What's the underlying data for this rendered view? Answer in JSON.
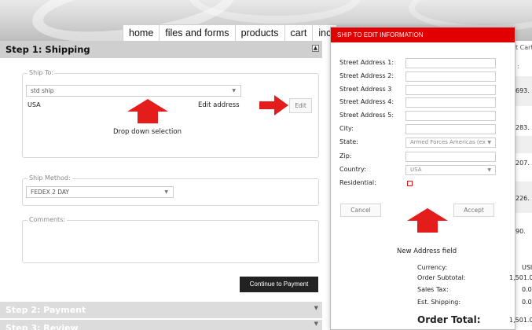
{
  "nav": {
    "items": [
      "home",
      "files and forms",
      "products",
      "cart",
      "inc"
    ]
  },
  "step1": {
    "title": "Step 1: Shipping",
    "toggle_icon": "collapse-icon",
    "ship_to": {
      "legend": "Ship To:",
      "selected": "std ship",
      "country": "USA",
      "edit_address_label": "Edit address",
      "edit_button": "Edit",
      "annotation": "Drop down selection"
    },
    "ship_method": {
      "legend": "Ship Method:",
      "selected": "FEDEX 2 DAY"
    },
    "comments": {
      "legend": "Comments:"
    },
    "continue_button": "Continue to Payment"
  },
  "step2": {
    "title": "Step 2: Payment"
  },
  "step3": {
    "title": "Step 3: Review"
  },
  "cart": {
    "header": "t Cart",
    "sub": ":",
    "rows": [
      "693.",
      "283.",
      "207.",
      "226.",
      "90."
    ]
  },
  "modal": {
    "title": "Ship to Edit Information",
    "fields": [
      {
        "label": "Street Address 1:",
        "value": ""
      },
      {
        "label": "Street Address 2:",
        "value": ""
      },
      {
        "label": "Street Address 3",
        "value": ""
      },
      {
        "label": "Street Address 4:",
        "value": ""
      },
      {
        "label": "Street Address 5:",
        "value": ""
      },
      {
        "label": "City:",
        "value": ""
      }
    ],
    "state_label": "State:",
    "state_value": "Armed Forces Americas (ex",
    "zip_label": "Zip:",
    "country_label": "Country:",
    "country_value": "USA",
    "residential_label": "Residential:",
    "cancel_button": "Cancel",
    "accept_button": "Accept",
    "annotation": "New Address field"
  },
  "totals": {
    "currency_label": "Currency:",
    "currency_value": "USI",
    "subtotal_label": "Order Subtotal:",
    "subtotal_value": "1,501.0",
    "tax_label": "Sales Tax:",
    "tax_value": "0.0",
    "shipping_label": "Est. Shipping:",
    "shipping_value": "0.0",
    "total_label": "Order Total:",
    "total_value": "1,501.0"
  },
  "colors": {
    "accent_red": "#e00000",
    "arrow_red": "#e41c1c",
    "step_header": "#cfcfcf"
  }
}
